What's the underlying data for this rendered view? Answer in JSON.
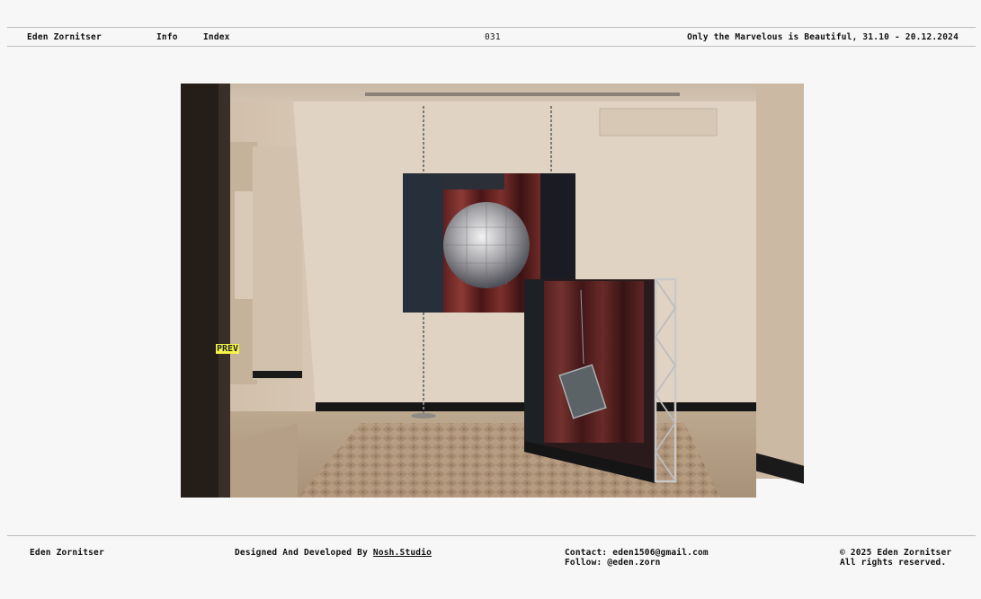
{
  "header": {
    "name": "Eden Zornitser",
    "nav": {
      "info": "Info",
      "index": "Index"
    },
    "counter": "031",
    "exhibition_title": "Only the Marvelous is Beautiful, 31.10 - 20.12.2024"
  },
  "gallery": {
    "prev_label": "PREV"
  },
  "footer": {
    "name": "Eden Zornitser",
    "credit_prefix": "Designed And Developed By ",
    "credit_link": "Nosh.Studio",
    "contact": "Contact: eden1506@gmail.com",
    "follow": "Follow: @eden.zorn",
    "copyright": "© 2025 Eden Zornitser",
    "rights": "All rights reserved."
  }
}
